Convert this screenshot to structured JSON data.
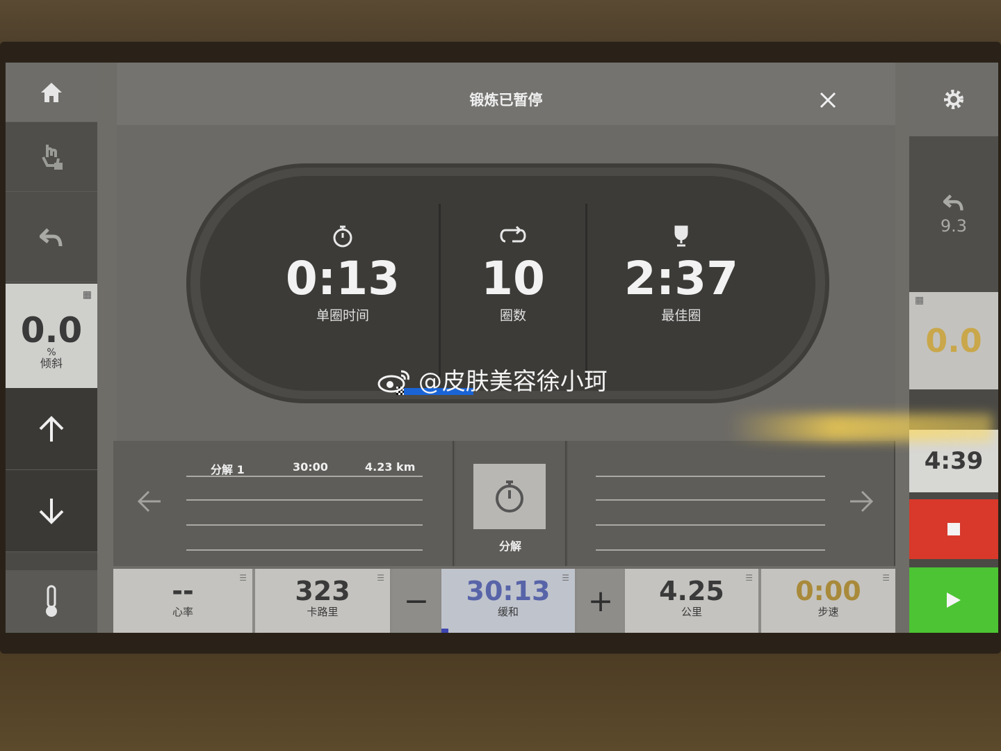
{
  "header": {
    "title": "锻炼已暂停",
    "close_icon": "close-icon"
  },
  "left": {
    "incline_value": "0.0",
    "incline_unit": "%",
    "incline_label": "倾斜"
  },
  "right": {
    "prev_value": "9.3",
    "speed_value": "0.0",
    "time_value": "4:39"
  },
  "stats": [
    {
      "icon": "stopwatch-icon",
      "value": "0:13",
      "label": "单圈时间"
    },
    {
      "icon": "loop-icon",
      "value": "10",
      "label": "圈数"
    },
    {
      "icon": "trophy-icon",
      "value": "2:37",
      "label": "最佳圈"
    }
  ],
  "splits": {
    "head_name": "分解 1",
    "head_time": "30:00",
    "head_dist": "4.23 km",
    "button_label": "分解"
  },
  "bottom": {
    "heart_value": "--",
    "heart_label": "心率",
    "cal_value": "323",
    "cal_label": "卡路里",
    "minus": "−",
    "time_value": "30:13",
    "time_label": "缓和",
    "plus": "+",
    "dist_value": "4.25",
    "dist_label": "公里",
    "pace_value": "0:00",
    "pace_label": "步速"
  },
  "watermark": "@皮肤美容徐小珂",
  "colors": {
    "stop": "#d8392b",
    "play": "#4cc433",
    "progress": "#1a64d6"
  }
}
